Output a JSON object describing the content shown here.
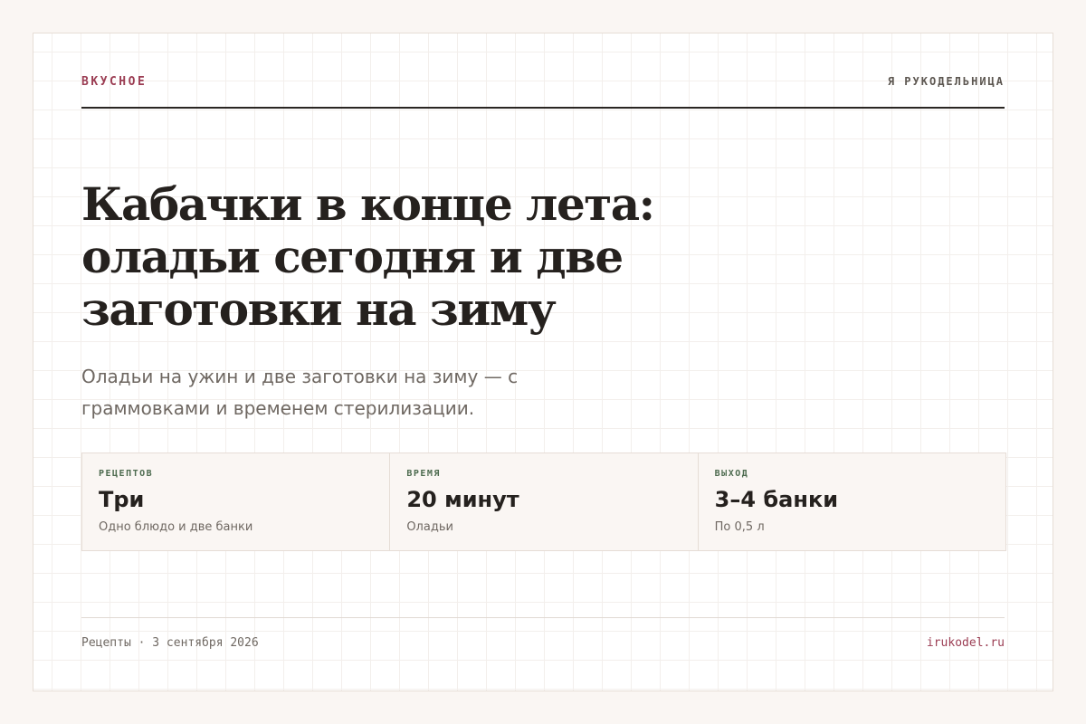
{
  "header": {
    "kicker": "ВКУСНОЕ",
    "brand": "Я РУКОДЕЛЬНИЦА"
  },
  "article": {
    "title": "Кабачки в конце лета: оладьи сегодня и две заготовки на зиму",
    "subtitle": "Оладьи на ужин и две заготовки на зиму — с граммовками и временем стерилизации."
  },
  "stats": [
    {
      "label": "РЕЦЕПТОВ",
      "value": "Три",
      "note": "Одно блюдо и две банки"
    },
    {
      "label": "ВРЕМЯ",
      "value": "20 минут",
      "note": "Оладьи"
    },
    {
      "label": "ВЫХОД",
      "value": "3–4 банки",
      "note": "По 0,5 л"
    }
  ],
  "footer": {
    "meta": "Рецепты · 3 сентября 2026",
    "site": "irukodel.ru"
  },
  "colors": {
    "accent": "#9b3d53",
    "label_green": "#4d6b4f",
    "text_dark": "#25211e",
    "text_muted": "#6f6862",
    "panel_bg": "#faf6f3"
  }
}
